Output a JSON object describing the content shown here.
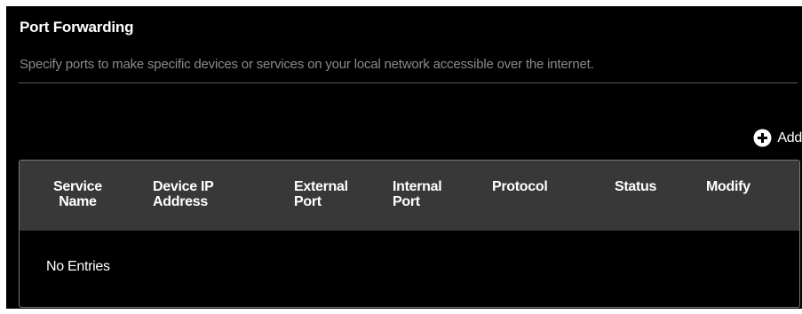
{
  "header": {
    "title": "Port Forwarding",
    "description": "Specify ports to make specific devices or services on your local network accessible over the internet."
  },
  "toolbar": {
    "add_label": "Add",
    "add_icon": "plus-circle-icon"
  },
  "table": {
    "columns": [
      {
        "line1": "Service",
        "line2": "Name"
      },
      {
        "line1": "Device IP",
        "line2": "Address"
      },
      {
        "line1": "External",
        "line2": "Port"
      },
      {
        "line1": "Internal",
        "line2": "Port"
      },
      {
        "line1": "Protocol",
        "line2": ""
      },
      {
        "line1": "Status",
        "line2": ""
      },
      {
        "line1": "Modify",
        "line2": ""
      }
    ],
    "empty_text": "No Entries"
  },
  "colors": {
    "background": "#000000",
    "header_bg": "#383838",
    "muted_text": "#8a8a8a",
    "border": "#7a7a7a"
  }
}
